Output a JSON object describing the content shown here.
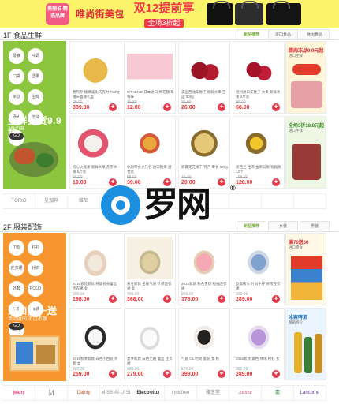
{
  "banner": {
    "badge": "美丽说\n精选品牌",
    "text": "唯尚街美包",
    "sale_big": "双12提前享",
    "sale_small": "全场3折起"
  },
  "floor1": {
    "title": "1F 食品生鲜",
    "tabs": [
      "新品推荐",
      "进口食品",
      "休闲食品"
    ],
    "categories": [
      "零食",
      "冲调",
      "口袋",
      "坚果",
      "茶饮",
      "生鲜",
      "酒水",
      "粮油",
      "米面"
    ],
    "promo_title": "生鲜尖货9.9起",
    "promo_sub": "3件包邮",
    "go": "GO",
    "side_top_title": "腊肉冻品9.9元起",
    "side_top_sub": "进口生鲜",
    "side_bottom_title": "全场5折18.8元起",
    "side_bottom_sub": "进口牛排",
    "products": [
      {
        "desc": "费列罗 榛果威化巧克力 T30粒 婚庆喜糖礼盒",
        "old": "99.00",
        "price": "389.00"
      },
      {
        "desc": "CRACKIE 日本进口 棉花糖 草莓味",
        "old": "19.80",
        "price": "12.00"
      },
      {
        "desc": "美国西北车厘子 新鲜水果 空运 500g",
        "old": "39.00",
        "price": "26.00"
      },
      {
        "desc": "智利进口车厘子 大果 新鲜水果 2斤装",
        "old": "99.00",
        "price": "68.00"
      },
      {
        "desc": "红心火龙果 新鲜水果 热带水果 5斤装",
        "old": "36.00",
        "price": "19.00"
      },
      {
        "desc": "休闲零食大礼包 进口糖果 混合装",
        "old": "58.00",
        "price": "39.00"
      },
      {
        "desc": "新疆无花果干 特产 零食 500g",
        "old": "45.00",
        "price": "29.00"
      },
      {
        "desc": "新西兰 佳沛 金奇异果 猕猴桃 12个",
        "old": "168.00",
        "price": "128.00"
      }
    ]
  },
  "floor2": {
    "title": "2F 服装配饰",
    "tabs": [
      "新品推荐",
      "女装",
      "男装"
    ],
    "categories": [
      "T恤",
      "衬衫",
      "连衣裙",
      "针织",
      "外套",
      "POLO",
      "毛衣",
      "裤装",
      "配件"
    ],
    "promo_title": "进口买一送一",
    "promo_sub": "活动时间 不见不散",
    "go": "GO",
    "side_top_title": "满70送30",
    "side_top_sub": "进口零食",
    "side_bottom_title": "冰爽啤酒",
    "side_bottom_sub": "整箱特价",
    "products": [
      {
        "desc": "2015春装新款 韩版修身蕾丝连衣裙 女",
        "old": "299.00",
        "price": "198.00"
      },
      {
        "desc": "秋冬新款 名媛气质 针织连衣裙 女",
        "old": "499.00",
        "price": "368.00"
      },
      {
        "desc": "2015新款 粉色雪纺 短袖连衣裙",
        "old": "259.00",
        "price": "178.00"
      },
      {
        "desc": "欧美街头 时尚牛仔 背带连衣裙",
        "old": "399.00",
        "price": "289.00"
      },
      {
        "desc": "2015秋季新款 白色小西装 外套 女",
        "old": "399.00",
        "price": "259.00"
      },
      {
        "desc": "夏季新款 白色无袖 蕾丝 连衣裙",
        "old": "369.00",
        "price": "279.00"
      },
      {
        "desc": "气质 OL 时尚 套装 女 秋",
        "old": "599.00",
        "price": "399.00"
      },
      {
        "desc": "2015新款 紫色 休闲 衬衫 女",
        "old": "359.00",
        "price": "289.00"
      }
    ]
  },
  "brands1": [
    "TORIO",
    "曼伽神",
    "维尼",
    "",
    "",
    "",
    "",
    "",
    "",
    ""
  ],
  "brands2": [
    "jeany",
    "M",
    "Dainty",
    "MISS·AI·LI·SI",
    "Electrolux",
    "innisfree",
    "雅芝堂",
    "Justina",
    "嘉",
    "Lancome"
  ],
  "watermark": {
    "text": "罗网",
    "reg": "®"
  }
}
